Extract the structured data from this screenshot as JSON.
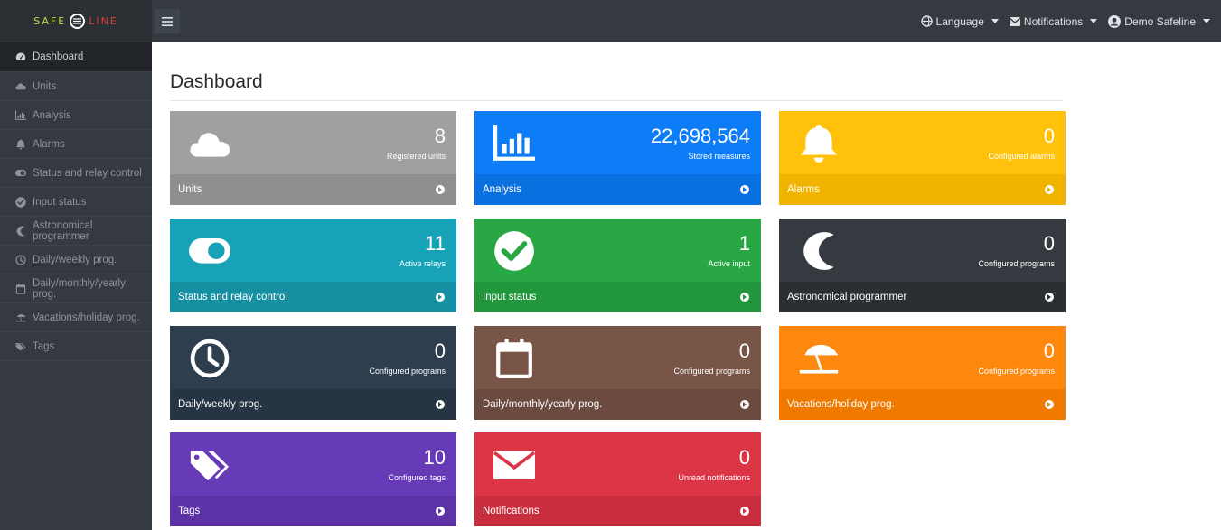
{
  "brand": {
    "left": "SAFE",
    "right": "LINE"
  },
  "topnav": {
    "language": "Language",
    "notifications": "Notifications",
    "user": "Demo Safeline"
  },
  "sidebar": {
    "items": [
      {
        "label": "Dashboard",
        "icon": "dashboard-icon",
        "active": true
      },
      {
        "label": "Units",
        "icon": "cloud-icon"
      },
      {
        "label": "Analysis",
        "icon": "chart-icon"
      },
      {
        "label": "Alarms",
        "icon": "bell-icon"
      },
      {
        "label": "Status and relay control",
        "icon": "toggle-icon"
      },
      {
        "label": "Input status",
        "icon": "check-circle-icon"
      },
      {
        "label": "Astronomical programmer",
        "icon": "moon-icon"
      },
      {
        "label": "Daily/weekly prog.",
        "icon": "clock-icon"
      },
      {
        "label": "Daily/monthly/yearly prog.",
        "icon": "calendar-icon"
      },
      {
        "label": "Vacations/holiday prog.",
        "icon": "umbrella-beach-icon"
      },
      {
        "label": "Tags",
        "icon": "tags-icon"
      }
    ]
  },
  "main": {
    "title": "Dashboard"
  },
  "cards": [
    {
      "value": "8",
      "subtitle": "Registered units",
      "footer": "Units",
      "icon": "cloud-icon",
      "color": "#a0a0a0",
      "foot_color": "#8f8f8f",
      "text_dark": false
    },
    {
      "value": "22,698,564",
      "subtitle": "Stored measures",
      "footer": "Analysis",
      "icon": "chart-icon",
      "color": "#0d7df7",
      "foot_color": "#0a6fdf"
    },
    {
      "value": "0",
      "subtitle": "Configured alarms",
      "footer": "Alarms",
      "icon": "bell-icon",
      "color": "#ffc10a",
      "foot_color": "#f0b400"
    },
    {
      "value": "11",
      "subtitle": "Active relays",
      "footer": "Status and relay control",
      "icon": "toggle-icon",
      "color": "#18a2b8",
      "foot_color": "#1590a3"
    },
    {
      "value": "1",
      "subtitle": "Active input",
      "footer": "Input status",
      "icon": "check-circle-icon",
      "color": "#28a744",
      "foot_color": "#22963c"
    },
    {
      "value": "0",
      "subtitle": "Configured programs",
      "footer": "Astronomical programmer",
      "icon": "moon-icon",
      "color": "#343a40",
      "foot_color": "#2a2f34"
    },
    {
      "value": "0",
      "subtitle": "Configured programs",
      "footer": "Daily/weekly prog.",
      "icon": "clock-icon",
      "color": "#2e3e4f",
      "foot_color": "#263444"
    },
    {
      "value": "0",
      "subtitle": "Configured programs",
      "footer": "Daily/monthly/yearly prog.",
      "icon": "calendar-icon",
      "color": "#795548",
      "foot_color": "#6b4a3f"
    },
    {
      "value": "0",
      "subtitle": "Configured programs",
      "footer": "Vacations/holiday prog.",
      "icon": "umbrella-beach-icon",
      "color": "#fe870d",
      "foot_color": "#f07a00"
    },
    {
      "value": "10",
      "subtitle": "Configured tags",
      "footer": "Tags",
      "icon": "tags-icon",
      "color": "#673ab7",
      "foot_color": "#5c32a6"
    },
    {
      "value": "0",
      "subtitle": "Unread notifications",
      "footer": "Notifications",
      "icon": "envelope-icon",
      "color": "#dc3546",
      "foot_color": "#c92e3e"
    }
  ]
}
